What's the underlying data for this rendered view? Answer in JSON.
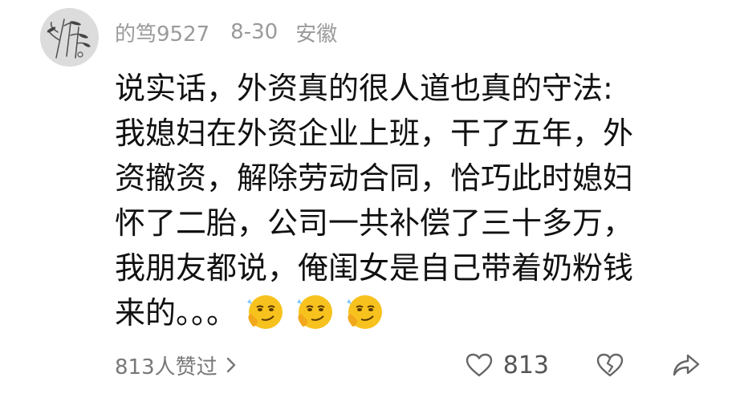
{
  "comment": {
    "username": "的笃9527",
    "date": "8-30",
    "location": "安徽",
    "text_lines": [
      "说实话，外资真的很人道也真的守法:",
      "我媳妇在外资企业上班，干了五年，外",
      "资撤资，解除劳动合同，恰巧此时媳妇",
      "怀了二胎，公司一共补偿了三十多万，",
      "我朋友都说，俺闺女是自己带着奶粉钱",
      "来的。。。"
    ],
    "emoji_names": [
      "smirk-emoji",
      "smirk-emoji",
      "smirk-emoji"
    ]
  },
  "footer": {
    "likes_summary": "813人赞过",
    "like_count": "813"
  },
  "colors": {
    "text": "#111111",
    "meta": "#9a9a9a",
    "icon": "#666666",
    "emoji_face": "#f7c21e"
  },
  "icons": {
    "like": "heart-icon",
    "dislike": "broken-heart-icon",
    "share": "share-arrow-icon",
    "chevron": "chevron-right-icon"
  }
}
